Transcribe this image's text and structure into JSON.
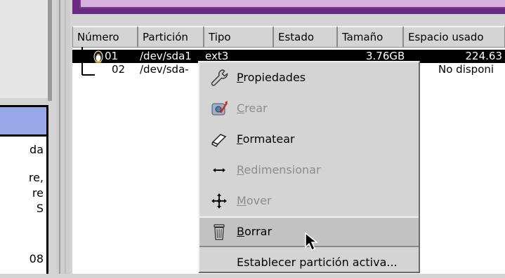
{
  "left_panel": {
    "text_lines": [
      "da",
      "re,",
      "re",
      "S",
      "08"
    ]
  },
  "table": {
    "columns": [
      "Número",
      "Partición",
      "Tipo",
      "Estado",
      "Tamaño",
      "Espacio usado"
    ],
    "rows": [
      {
        "numero": "01",
        "particion": "/dev/sda1",
        "tipo": "ext3",
        "estado": "",
        "tamano": "3.76GB",
        "espacio": "224.63",
        "selected": true
      },
      {
        "numero": "02",
        "particion": "/dev/sda-",
        "tipo": "",
        "estado": "",
        "tamano": "",
        "espacio": "No disponi",
        "selected": false
      }
    ]
  },
  "context_menu": {
    "items": [
      {
        "label": "Propiedades",
        "accel": "P",
        "rest": "ropiedades",
        "icon": "wrench-icon",
        "enabled": true
      },
      {
        "label": "Crear",
        "accel": "C",
        "rest": "rear",
        "icon": "create-disk-icon",
        "enabled": false
      },
      {
        "label": "Formatear",
        "accel": "F",
        "rest": "ormatear",
        "icon": "eraser-icon",
        "enabled": true
      },
      {
        "label": "Redimensionar",
        "accel": "R",
        "rest": "edimensionar",
        "icon": "resize-arrows-icon",
        "enabled": false
      },
      {
        "label": "Mover",
        "accel": "M",
        "rest": "over",
        "icon": "move-arrows-icon",
        "enabled": false
      },
      {
        "label": "Borrar",
        "accel": "B",
        "rest": "orrar",
        "icon": "trash-icon",
        "enabled": true,
        "hover": true
      },
      {
        "label": "Establecer partición activa...",
        "accel": "",
        "rest": "Establecer partición activa...",
        "icon": "",
        "enabled": true
      }
    ]
  }
}
